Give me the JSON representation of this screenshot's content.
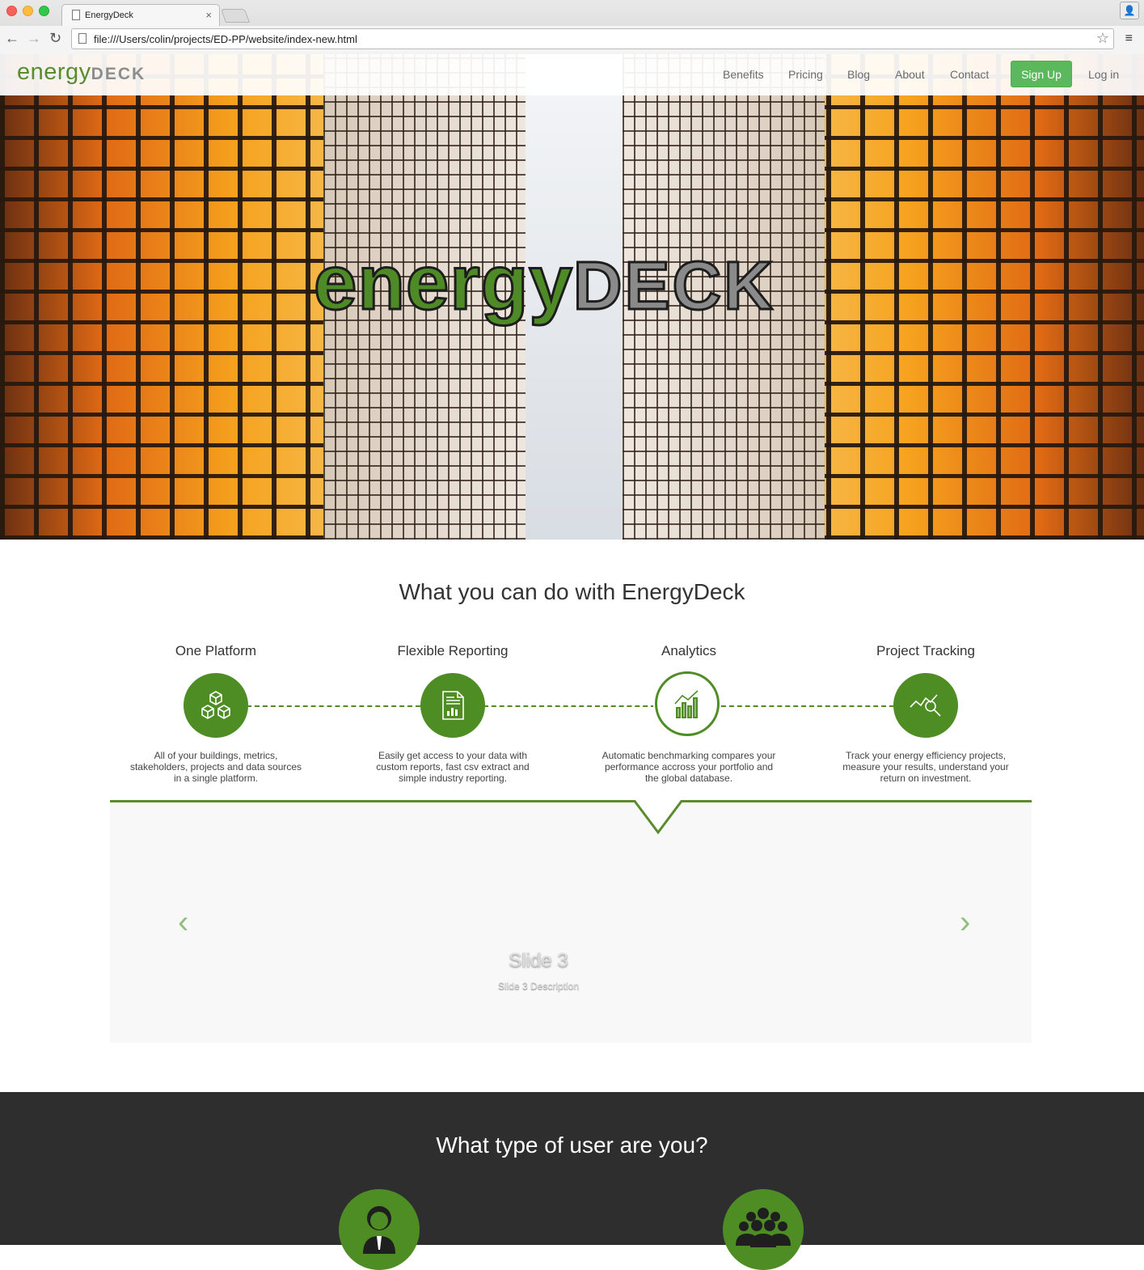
{
  "browser": {
    "tab_title": "EnergyDeck",
    "tab_close": "×",
    "url": "file:///Users/colin/projects/ED-PP/website/index-new.html",
    "back": "←",
    "forward": "→",
    "reload": "↻",
    "star": "☆",
    "menu": "≡",
    "profile": "👤"
  },
  "navbar": {
    "logo_green": "energy",
    "logo_grey": "DECK",
    "links": [
      "Benefits",
      "Pricing",
      "Blog",
      "About",
      "Contact"
    ],
    "signup": "Sign Up",
    "login": "Log in"
  },
  "hero": {
    "logo_green": "energy",
    "logo_grey": "DECK"
  },
  "features": {
    "title": "What you can do with EnergyDeck",
    "items": [
      {
        "title": "One Platform",
        "icon": "cubes-icon",
        "lines": [
          "All of your buildings, metrics,",
          "stakeholders, projects and data sources",
          "in a single platform."
        ]
      },
      {
        "title": "Flexible Reporting",
        "icon": "report-icon",
        "lines": [
          "Easily get access to your data with",
          "custom reports, fast csv extract and",
          "simple industry reporting."
        ]
      },
      {
        "title": "Analytics",
        "icon": "chart-icon",
        "lines": [
          "Automatic benchmarking compares your",
          "performance accross your portfolio and",
          "the global database."
        ]
      },
      {
        "title": "Project Tracking",
        "icon": "magnifier-trend-icon",
        "lines": [
          "Track your energy efficiency projects,",
          "measure your results, understand your",
          "return on investment."
        ]
      }
    ],
    "active_index": 2,
    "colors": {
      "accent": "#4e8c24"
    }
  },
  "slider": {
    "title": "Slide 3",
    "description": "Slide 3 Description",
    "prev": "‹",
    "next": "›"
  },
  "users": {
    "title": "What type of user are you?",
    "icons": [
      "person-icon",
      "group-icon"
    ]
  }
}
